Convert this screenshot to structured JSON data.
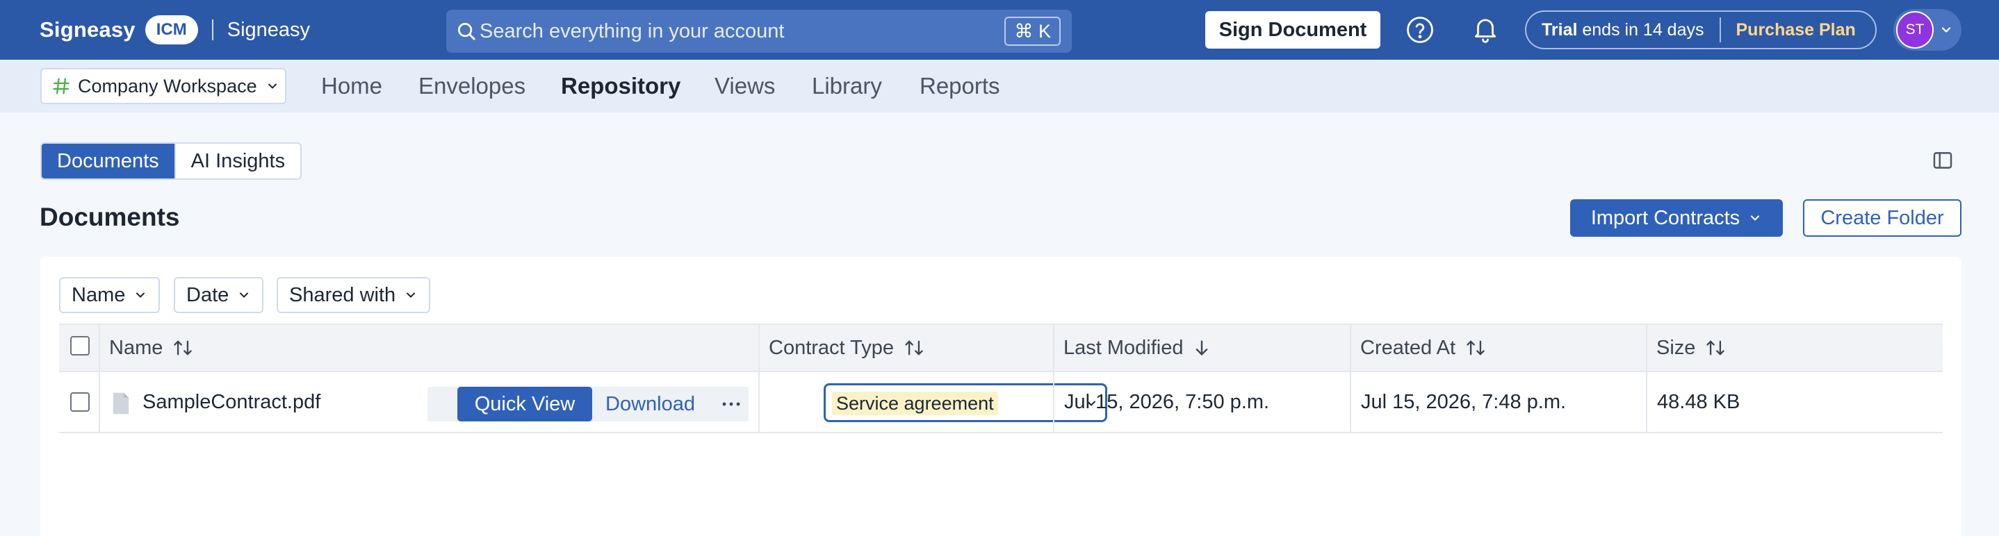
{
  "brand": {
    "name": "Signeasy",
    "badge": "ICM",
    "product": "Signeasy"
  },
  "search": {
    "placeholder": "Search everything in your account",
    "shortcut": "⌘ K"
  },
  "header": {
    "sign_label": "Sign Document",
    "trial_strong": "Trial",
    "trial_rest": " ends in 14 days",
    "purchase_label": "Purchase Plan",
    "avatar_initials": "ST"
  },
  "workspace": {
    "label": "Company Workspace"
  },
  "nav": {
    "items": [
      {
        "label": "Home"
      },
      {
        "label": "Envelopes"
      },
      {
        "label": "Repository"
      },
      {
        "label": "Views"
      },
      {
        "label": "Library"
      },
      {
        "label": "Reports"
      }
    ],
    "active": "Repository"
  },
  "tabs": [
    {
      "label": "Documents"
    },
    {
      "label": "AI Insights"
    }
  ],
  "page": {
    "title": "Documents",
    "import_label": "Import Contracts",
    "create_label": "Create Folder"
  },
  "filters": [
    {
      "label": "Name"
    },
    {
      "label": "Date"
    },
    {
      "label": "Shared with"
    }
  ],
  "table": {
    "columns": [
      {
        "label": "Name"
      },
      {
        "label": "Contract Type"
      },
      {
        "label": "Last Modified"
      },
      {
        "label": "Created At"
      },
      {
        "label": "Size"
      }
    ],
    "rows": [
      {
        "name": "SampleContract.pdf",
        "quick_view": "Quick View",
        "download": "Download",
        "contract_type": "Service agreement",
        "last_modified": "Jul 15, 2026, 7:50 p.m.",
        "created_at": "Jul 15, 2026, 7:48 p.m.",
        "size": "48.48 KB"
      }
    ]
  },
  "colors": {
    "brand_blue": "#2c58a8",
    "accent": "#2f61b8",
    "trial_accent": "#ffd88a",
    "avatar": "#8e35e0"
  }
}
